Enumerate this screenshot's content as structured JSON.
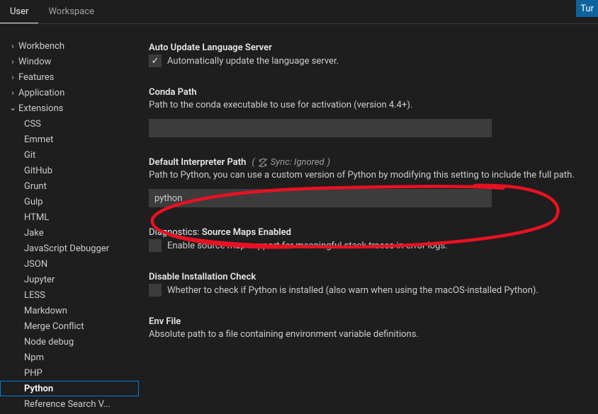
{
  "tabs": {
    "user": "User",
    "workspace": "Workspace"
  },
  "turn_button": "Tur",
  "tree": {
    "workbench": "Workbench",
    "window": "Window",
    "features": "Features",
    "application": "Application",
    "extensions": "Extensions",
    "children": [
      "CSS",
      "Emmet",
      "Git",
      "GitHub",
      "Grunt",
      "Gulp",
      "HTML",
      "Jake",
      "JavaScript Debugger",
      "JSON",
      "Jupyter",
      "LESS",
      "Markdown",
      "Merge Conflict",
      "Node debug",
      "Npm",
      "PHP",
      "Python",
      "Reference Search V..."
    ]
  },
  "settings": {
    "auto_update": {
      "title": "Auto Update Language Server",
      "label": "Automatically update the language server."
    },
    "conda": {
      "title": "Conda Path",
      "desc": "Path to the conda executable to use for activation (version 4.4+)."
    },
    "interpreter": {
      "title": "Default Interpreter Path",
      "sync_label": "Sync: Ignored",
      "desc": "Path to Python, you can use a custom version of Python by modifying this setting to include the full path.",
      "value": "python"
    },
    "diagnostics": {
      "title_prefix": "Diagnostics:",
      "title_bold": "Source Maps Enabled",
      "label": "Enable source map support for meaningful stack traces in error logs."
    },
    "disable_check": {
      "title": "Disable Installation Check",
      "label": "Whether to check if Python is installed (also warn when using the macOS-installed Python)."
    },
    "envfile": {
      "title": "Env File",
      "desc": "Absolute path to a file containing environment variable definitions."
    }
  }
}
